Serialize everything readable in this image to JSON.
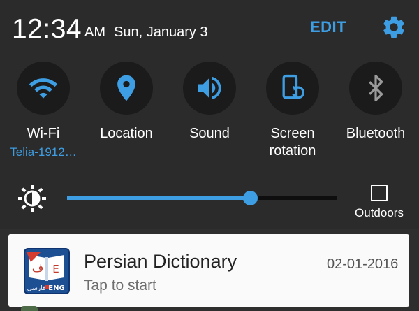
{
  "status": {
    "time": "12:34",
    "ampm": "AM",
    "date": "Sun, January 3",
    "edit_label": "EDIT"
  },
  "quick_settings": [
    {
      "label": "Wi-Fi",
      "sub": "Telia-1912…",
      "icon": "wifi-icon"
    },
    {
      "label": "Location",
      "sub": "",
      "icon": "location-pin-icon"
    },
    {
      "label": "Sound",
      "sub": "",
      "icon": "speaker-icon"
    },
    {
      "label": "Screen rotation",
      "sub": "",
      "icon": "screen-rotation-icon"
    },
    {
      "label": "Bluetooth",
      "sub": "",
      "icon": "bluetooth-icon"
    }
  ],
  "brightness": {
    "level": 0.68,
    "outdoors_label": "Outdoors",
    "outdoors_checked": false
  },
  "notification": {
    "app_name": "Persian Dictionary",
    "text": "Tap to start",
    "date": "02-01-2016",
    "icon_glyphs": {
      "left": "ف",
      "right": "E",
      "bottom_left": "فارسی",
      "bottom_right": "ENG"
    }
  },
  "colors": {
    "accent": "#3e9ee3",
    "background": "#2b2b2b",
    "tile_circle": "#1b1b1b",
    "card": "#fafafa"
  }
}
